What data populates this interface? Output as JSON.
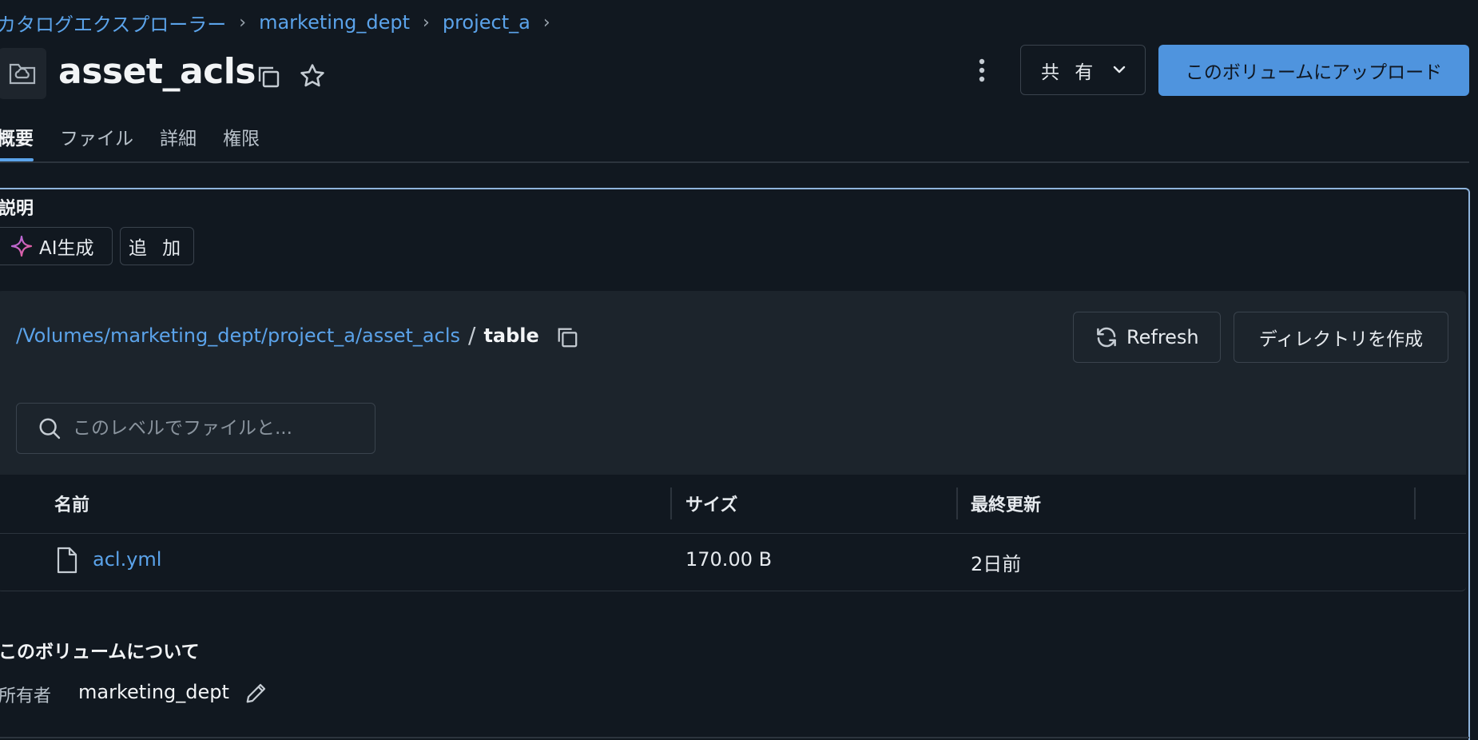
{
  "breadcrumb": {
    "items": [
      "カタログエクスプローラー",
      "marketing_dept",
      "project_a"
    ],
    "separator": "›"
  },
  "header": {
    "title": "asset_acls",
    "share_label": "共 有",
    "upload_label": "このボリュームにアップロード"
  },
  "tabs": [
    "概要",
    "ファイル",
    "詳細",
    "権限"
  ],
  "description": {
    "label": "説明",
    "ai_button": "AI生成",
    "add_button": "追 加"
  },
  "browser": {
    "path_link": "/Volumes/marketing_dept/project_a/asset_acls",
    "path_sep": "/",
    "current_dir": "table",
    "refresh_label": "Refresh",
    "mkdir_label": "ディレクトリを作成",
    "search_placeholder": "このレベルでファイルと..."
  },
  "table": {
    "columns": [
      "名前",
      "サイズ",
      "最終更新"
    ],
    "rows": [
      {
        "name": "acl.yml",
        "size": "170.00 B",
        "modified": "2日前"
      }
    ]
  },
  "about": {
    "title": "このボリュームについて",
    "owner_label": "所有者",
    "owner_value": "marketing_dept"
  },
  "colors": {
    "background": "#111820",
    "panel": "#1c242c",
    "accent": "#5ba3ea",
    "primary_button": "#4f94de",
    "selected_border": "#8fb4dc"
  },
  "icons": [
    "volume-icon",
    "copy-icon",
    "star-icon",
    "kebab-menu-icon",
    "chevron-down-icon",
    "sparkle-icon",
    "refresh-icon",
    "search-icon",
    "file-icon",
    "pencil-icon"
  ]
}
